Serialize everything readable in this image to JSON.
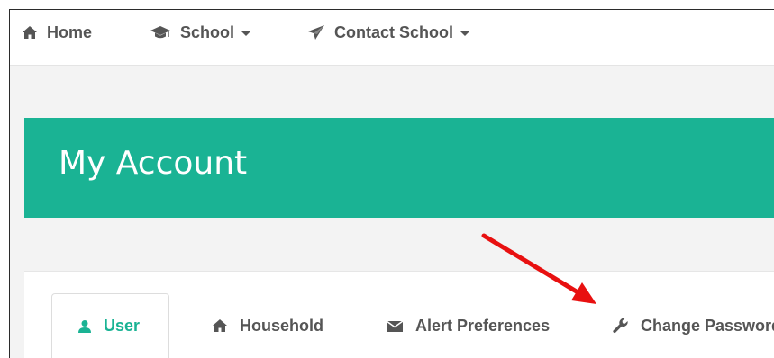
{
  "nav": {
    "home": {
      "label": "Home",
      "icon": "home-icon"
    },
    "school": {
      "label": "School",
      "icon": "graduation-cap-icon"
    },
    "contact": {
      "label": "Contact School",
      "icon": "paper-plane-icon"
    }
  },
  "banner": {
    "title": "My Account"
  },
  "tabs": [
    {
      "label": "User",
      "icon": "user-icon",
      "active": true
    },
    {
      "label": "Household",
      "icon": "home-icon",
      "active": false
    },
    {
      "label": "Alert Preferences",
      "icon": "envelope-icon",
      "active": false
    },
    {
      "label": "Change Password",
      "icon": "wrench-icon",
      "active": false
    }
  ],
  "colors": {
    "accent": "#1ab394",
    "text": "#555555",
    "arrow": "#e81010"
  }
}
